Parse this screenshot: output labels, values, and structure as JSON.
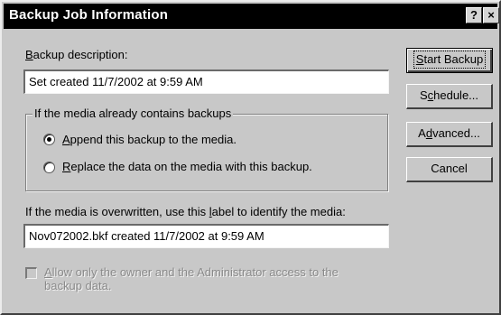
{
  "window": {
    "title": "Backup Job Information",
    "help_glyph": "?",
    "close_glyph": "×"
  },
  "description": {
    "label_first": "B",
    "label_rest": "ackup description:",
    "value": "Set created 11/7/2002 at 9:59 AM"
  },
  "media_group": {
    "legend": "If the media already contains backups",
    "append": {
      "label_pre": "",
      "label_ul": "A",
      "label_post": "ppend this backup to the media.",
      "selected": true
    },
    "replace": {
      "label_pre": "",
      "label_ul": "R",
      "label_post": "eplace the data on the media with this backup.",
      "selected": false
    }
  },
  "media_label": {
    "label_pre": "If the media is overwritten, use this ",
    "label_ul": "l",
    "label_post": "abel to identify the media:",
    "value": "Nov072002.bkf created 11/7/2002 at 9:59 AM"
  },
  "restrict_access": {
    "line1_ul": "A",
    "line1_rest": "llow only the owner and the Administrator access to the",
    "line2": "backup data.",
    "checked": false,
    "enabled": false
  },
  "buttons": {
    "start_backup": {
      "ul": "S",
      "rest": "tart Backup"
    },
    "schedule": {
      "pre": "S",
      "ul": "c",
      "post": "hedule..."
    },
    "advanced": {
      "pre": "A",
      "ul": "d",
      "post": "vanced..."
    },
    "cancel": "Cancel"
  }
}
